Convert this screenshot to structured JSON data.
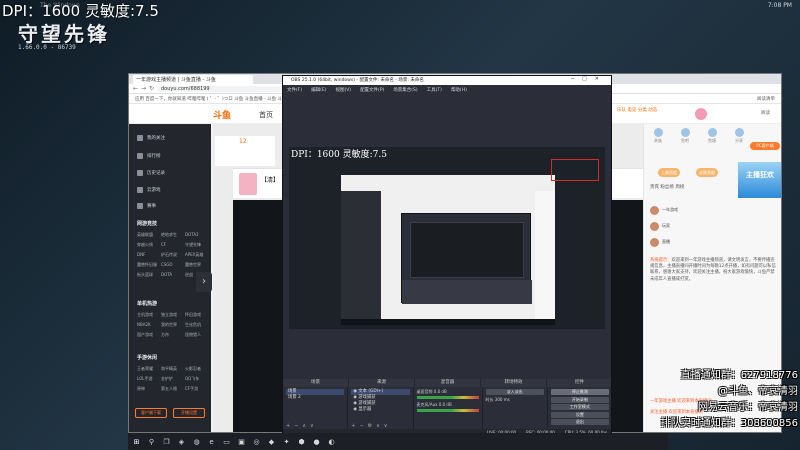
{
  "overlay": {
    "dpi_text": "DPI：1600 灵敏度:7.5",
    "brand_text": "守望先锋",
    "version": "1.66.0.0 - 86739",
    "clock": "7:08 PM",
    "desktop_title": "The Windows"
  },
  "browser": {
    "tab_title": "一年游戏主播频道 | 斗鱼直播 - 斗鱼",
    "url": "douyu.com/688199",
    "bookmarks": "应用   百度一下，你就知道   哔哩哔哩 ( ゜- ゜)つロ   斗鱼   斗鱼直播 - 斗鱼   斗鱼直播",
    "right_bookmark": "阅读清单"
  },
  "douyu": {
    "logo": "斗鱼",
    "home": "首页",
    "nav_items": "乐队  电竞  分类  动态",
    "right_nav": "阅读",
    "count": "12",
    "video_title": "【清】",
    "sidebar": {
      "items": [
        {
          "label": "我的关注",
          "icon": "heart-icon"
        },
        {
          "label": "排行榜",
          "icon": "ranking-icon"
        },
        {
          "label": "历史记录",
          "icon": "history-icon"
        },
        {
          "label": "云游戏",
          "icon": "cloud-game-icon"
        },
        {
          "label": "赛事",
          "icon": "trophy-icon"
        }
      ],
      "sections": [
        {
          "title": "网游竞技",
          "items": [
            "英雄联盟",
            "绝地求生",
            "DOTA2",
            "穿越火线",
            "CF",
            "守望先锋",
            "DNF",
            "炉石传说",
            "APEX英雄",
            "魔兽怀旧服",
            "CSGO",
            "魔兽世界",
            "街头篮球",
            "DOTA",
            "逆战"
          ]
        },
        {
          "title": "单机热游",
          "items": [
            "主机游戏",
            "独立游戏",
            "怀旧游戏",
            "NBA2K",
            "我的世界",
            "生化危机",
            "国产游戏",
            "方舟",
            "怪物猎人"
          ]
        },
        {
          "title": "手游休闲",
          "items": [
            "王者荣耀",
            "和平精英",
            "火影忍者",
            "LOL手游",
            "金铲铲",
            "QQ飞车",
            "原神",
            "第五人格",
            "CF手游"
          ]
        }
      ],
      "btn_download": "客户端下载",
      "btn_start": "开播设置"
    },
    "right": {
      "gifts": [
        "贵族",
        "鱼吧",
        "鱼塘",
        "分享"
      ],
      "pc_btn": "PC客户端",
      "promo": "主播狂欢",
      "rank_tabs": "贵宾   粉丝榜   周榜",
      "tab_btn1": "上周贡献",
      "tab_btn2": "本周贡献",
      "rank_rows": [
        "一年游戏",
        "玩家",
        "直播"
      ],
      "chat_sys": "系统提示：",
      "chat_body": "欢迎来到一年游戏主播频道，请文明发言，不要传播违规信息，主播直播间开播时间为每晚12点开播，如有问题可以私信联系，感谢大家支持，欢迎关注主播，祝大家游戏愉快，斗鱼严禁未成年人直播或打赏。",
      "chat_line1": "一年游戏主播 欢迎来到本直播间",
      "chat_line2": "关注主播 欢迎来到本直播间"
    }
  },
  "obs": {
    "title": "OBS 25.1.0 (64bit, windows) - 配置文件: 未命名 - 场景: 未命名",
    "menu": [
      "文件(F)",
      "编辑(E)",
      "视图(V)",
      "配置文件(P)",
      "场景集合(S)",
      "工具(T)",
      "帮助(H)"
    ],
    "preview_dpi": "DPI：1600 灵敏度:7.5",
    "docks": [
      "场景",
      "来源",
      "混音器",
      "转场特效",
      "控件"
    ],
    "scenes": [
      "场景",
      "场景 2"
    ],
    "sources": [
      "文本 (GDI+)",
      "游戏捕获",
      "游戏捕获",
      "显示器"
    ],
    "mixer": [
      "桌面音频",
      "麦克风/Aux"
    ],
    "mixer_db": [
      "0.0 dB",
      "0.0 dB"
    ],
    "transition": "淡入淡出",
    "duration_label": "时长",
    "duration": "300 ms",
    "controls": [
      "停止推流",
      "开始录制",
      "工作室模式",
      "设置",
      "退出"
    ],
    "status": [
      "LIVE: 00:00:00",
      "REC: 00:00:00",
      "CPU: 3.5%, 60.00 fps"
    ]
  },
  "bottom_overlay": {
    "line1": "直播通知群：627918776",
    "line2": "@斗鱼、帝哀清羽",
    "line3": "网易云音乐：帝哀清羽",
    "line4": "排队实时通知群：308600856"
  }
}
